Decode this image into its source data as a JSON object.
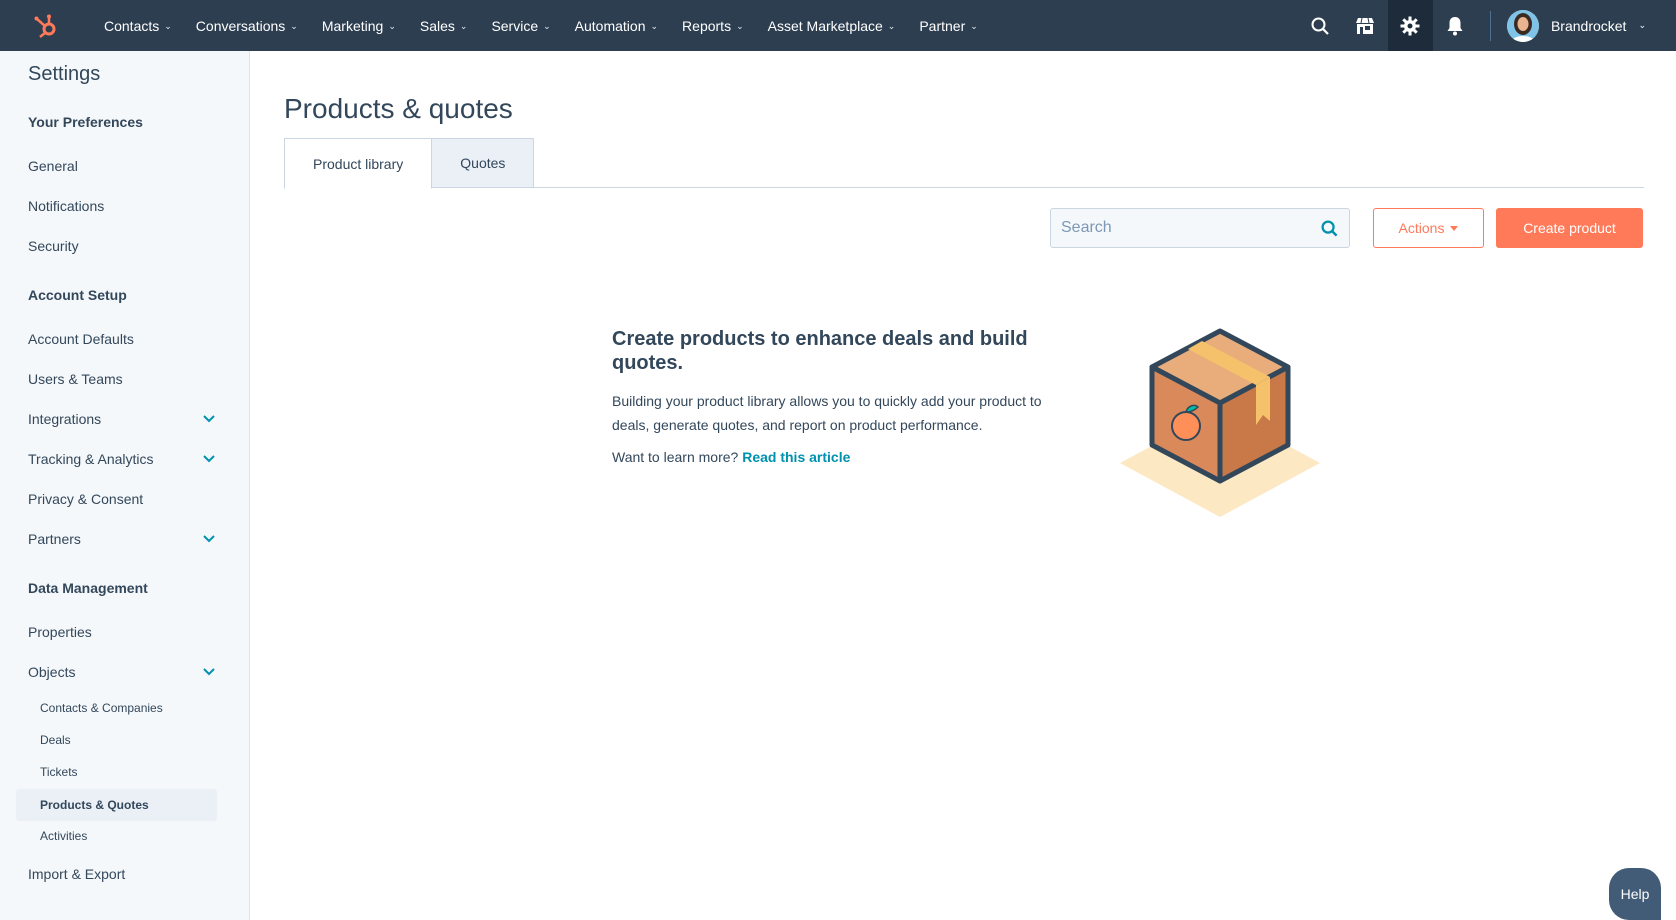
{
  "topnav": {
    "items": [
      {
        "label": "Contacts"
      },
      {
        "label": "Conversations"
      },
      {
        "label": "Marketing"
      },
      {
        "label": "Sales"
      },
      {
        "label": "Service"
      },
      {
        "label": "Automation"
      },
      {
        "label": "Reports"
      },
      {
        "label": "Asset Marketplace"
      },
      {
        "label": "Partner"
      }
    ],
    "account_name": "Brandrocket",
    "icons": [
      "hubspot-logo-icon",
      "search-icon",
      "marketplace-icon",
      "gear-icon",
      "bell-icon"
    ]
  },
  "sidebar": {
    "title": "Settings",
    "sections": {
      "preferences": "Your Preferences",
      "account_setup": "Account Setup",
      "data_management": "Data Management"
    },
    "items": {
      "general": "General",
      "notifications": "Notifications",
      "security": "Security",
      "account_defaults": "Account Defaults",
      "users_teams": "Users & Teams",
      "integrations": "Integrations",
      "tracking": "Tracking & Analytics",
      "privacy": "Privacy & Consent",
      "partners": "Partners",
      "properties": "Properties",
      "objects": "Objects",
      "contacts_companies": "Contacts & Companies",
      "deals": "Deals",
      "tickets": "Tickets",
      "products_quotes": "Products & Quotes",
      "activities": "Activities",
      "import_export": "Import & Export"
    }
  },
  "main": {
    "title": "Products & quotes",
    "tabs": [
      {
        "label": "Product library"
      },
      {
        "label": "Quotes"
      }
    ],
    "search_placeholder": "Search",
    "actions_label": "Actions",
    "create_label": "Create product",
    "empty_title": "Create products to enhance deals and build quotes.",
    "empty_text": "Building your product library allows you to quickly add your product to deals, generate quotes, and report on product performance.",
    "learn_prefix": "Want to learn more? ",
    "learn_link": "Read this article"
  },
  "help_label": "Help",
  "colors": {
    "nav_bg": "#2d3e50",
    "accent": "#ff7a59",
    "link": "#0091ae",
    "sidebar_bg": "#f5f8fa"
  }
}
